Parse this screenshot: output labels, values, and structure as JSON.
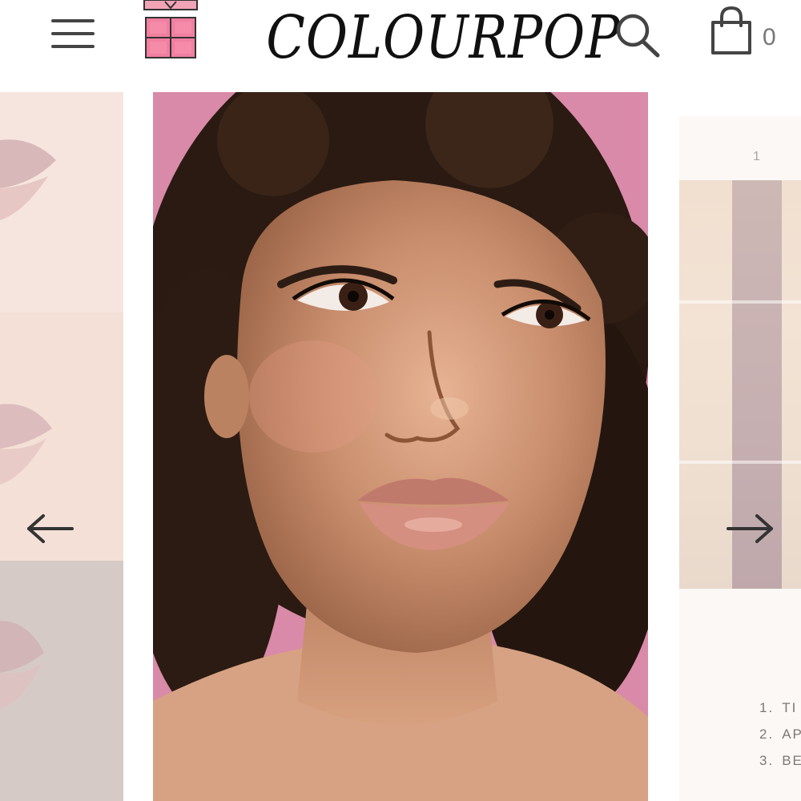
{
  "header": {
    "logo": "COLOURPOP",
    "cart_count": "0",
    "icons": {
      "menu": "hamburger-menu-icon",
      "palette": "eyeshadow-palette-icon",
      "search": "search-icon",
      "cart": "shopping-bag-icon"
    }
  },
  "carousel": {
    "prev_icon": "arrow-left-icon",
    "next_icon": "arrow-right-icon",
    "swatch_number": "1",
    "shades": [
      {
        "num": "1.",
        "name": "TI"
      },
      {
        "num": "2.",
        "name": "AP"
      },
      {
        "num": "3.",
        "name": "BE"
      }
    ]
  },
  "colors": {
    "accent_pink": "#f07fa0",
    "backdrop_pink": "#d98aa8",
    "icon_gray": "#444444"
  }
}
